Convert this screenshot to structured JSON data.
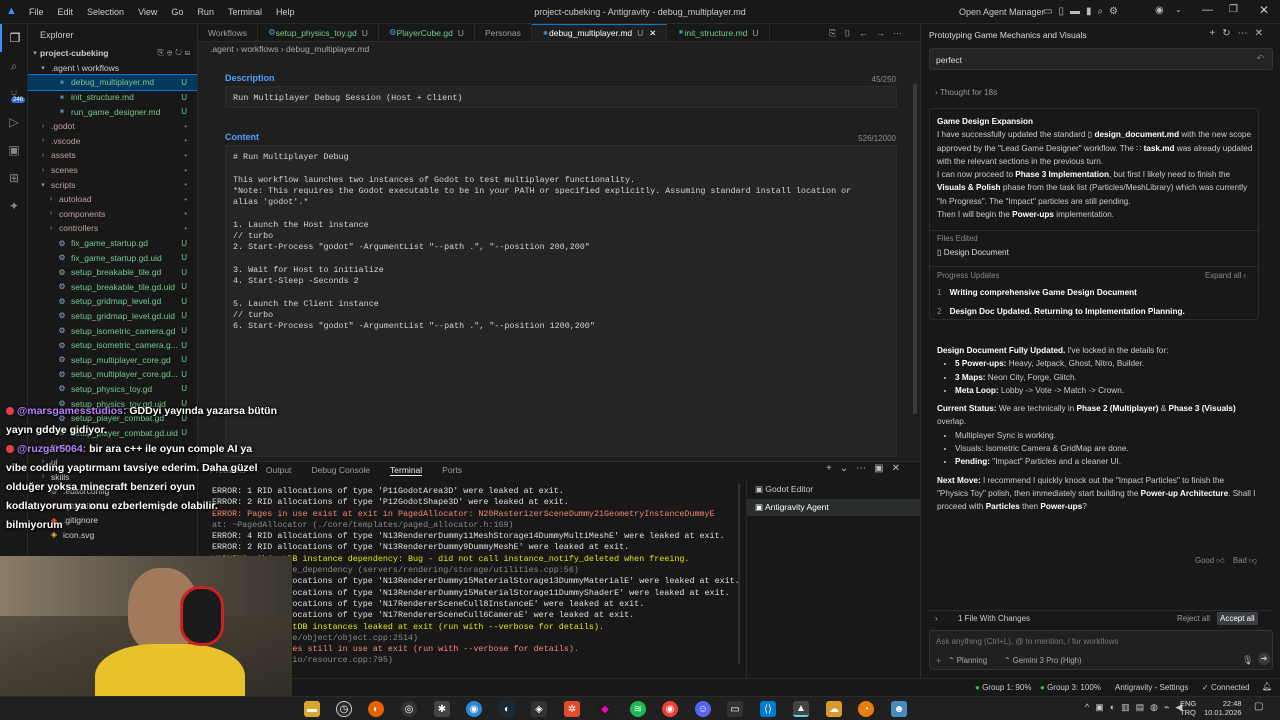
{
  "titlebar": {
    "menus": [
      "File",
      "Edit",
      "Selection",
      "View",
      "Go",
      "Run",
      "Terminal",
      "Help"
    ],
    "window_title": "project-cubeking - Antigravity - debug_multiplayer.md",
    "open_agent_manager": "Open Agent Manager"
  },
  "activity": {
    "badge": "246"
  },
  "explorer": {
    "header": "Explorer",
    "root": "project-cubeking",
    "items": [
      {
        "label": ".agent \\ workflows",
        "kind": "folder-open",
        "depth": 1
      },
      {
        "label": "debug_multiplayer.md",
        "kind": "md",
        "depth": 2,
        "status": "U",
        "selected": true
      },
      {
        "label": "init_structure.md",
        "kind": "md",
        "depth": 2,
        "status": "U"
      },
      {
        "label": "run_game_designer.md",
        "kind": "md",
        "depth": 2,
        "status": "U"
      },
      {
        "label": ".godot",
        "kind": "folder",
        "depth": 1,
        "status": "•"
      },
      {
        "label": ".vscode",
        "kind": "folder",
        "depth": 1,
        "status": "•"
      },
      {
        "label": "assets",
        "kind": "folder",
        "depth": 1,
        "status": "•"
      },
      {
        "label": "scenes",
        "kind": "folder",
        "depth": 1,
        "status": "•"
      },
      {
        "label": "scripts",
        "kind": "folder-open",
        "depth": 1,
        "status": "•"
      },
      {
        "label": "autoload",
        "kind": "folder",
        "depth": 2,
        "status": "•"
      },
      {
        "label": "components",
        "kind": "folder",
        "depth": 2,
        "status": "•"
      },
      {
        "label": "controllers",
        "kind": "folder",
        "depth": 2,
        "status": "•"
      },
      {
        "label": "fix_game_startup.gd",
        "kind": "gd",
        "depth": 2,
        "status": "U"
      },
      {
        "label": "fix_game_startup.gd.uid",
        "kind": "uid",
        "depth": 2,
        "status": "U"
      },
      {
        "label": "setup_breakable_tile.gd",
        "kind": "gd",
        "depth": 2,
        "status": "U"
      },
      {
        "label": "setup_breakable_tile.gd.uid",
        "kind": "uid",
        "depth": 2,
        "status": "U"
      },
      {
        "label": "setup_gridmap_level.gd",
        "kind": "gd",
        "depth": 2,
        "status": "U"
      },
      {
        "label": "setup_gridmap_level.gd.uid",
        "kind": "uid",
        "depth": 2,
        "status": "U"
      },
      {
        "label": "setup_isometric_camera.gd",
        "kind": "gd",
        "depth": 2,
        "status": "U"
      },
      {
        "label": "setup_isometric_camera.g...",
        "kind": "uid",
        "depth": 2,
        "status": "U"
      },
      {
        "label": "setup_multiplayer_core.gd",
        "kind": "gd",
        "depth": 2,
        "status": "U"
      },
      {
        "label": "setup_multiplayer_core.gd...",
        "kind": "uid",
        "depth": 2,
        "status": "U"
      },
      {
        "label": "setup_physics_toy.gd",
        "kind": "gd",
        "depth": 2,
        "status": "U"
      },
      {
        "label": "setup_physics_toy.gd.uid",
        "kind": "uid",
        "depth": 2,
        "status": "U"
      },
      {
        "label": "setup_player_combat.gd",
        "kind": "gd",
        "depth": 2,
        "status": "U"
      },
      {
        "label": "setup_player_combat.gd.uid",
        "kind": "uid",
        "depth": 2,
        "status": "U"
      },
      {
        "label": "tools",
        "kind": "folder",
        "depth": 1
      },
      {
        "label": "ui",
        "kind": "folder",
        "depth": 1
      },
      {
        "label": "skills",
        "kind": "folder",
        "depth": 1
      },
      {
        "label": ".editorconfig",
        "kind": "cfg",
        "depth": 1
      },
      {
        "label": ".gitattributes",
        "kind": "git",
        "depth": 1
      },
      {
        "label": ".gitignore",
        "kind": "git",
        "depth": 1
      },
      {
        "label": "icon.svg",
        "kind": "svg",
        "depth": 1
      }
    ]
  },
  "tabs": [
    {
      "label": "Workflows",
      "mod": ""
    },
    {
      "label": "setup_physics_toy.gd",
      "mod": "U"
    },
    {
      "label": "PlayerCube.gd",
      "mod": "U"
    },
    {
      "label": "Personas",
      "mod": ""
    },
    {
      "label": "debug_multiplayer.md",
      "mod": "U",
      "active": true
    },
    {
      "label": "init_structure.md",
      "mod": "U"
    }
  ],
  "breadcrumb": ".agent › workflows › debug_multiplayer.md",
  "description": {
    "label": "Description",
    "count": "45/250",
    "value": "Run Multiplayer Debug Session (Host + Client)"
  },
  "content": {
    "label": "Content",
    "count": "526/12000",
    "lines": [
      "# Run Multiplayer Debug",
      "",
      "This workflow launches two instances of Godot to test multiplayer functionality.",
      "*Note: This requires the Godot executable to be in your PATH or specified explicitly. Assuming standard install location or",
      "alias 'godot'.*",
      "",
      "1. Launch the Host instance",
      "// turbo",
      "2. Start-Process \"godot\" -ArgumentList \"--path .\", \"--position 200,200\"",
      "",
      "3. Wait for Host to initialize",
      "4. Start-Sleep -Seconds 2",
      "",
      "5. Launch the Client instance",
      "// turbo",
      "6. Start-Process \"godot\" -ArgumentList \"--path .\", \"--position 1200,200\""
    ]
  },
  "panel": {
    "tabs": [
      "Problems",
      "Output",
      "Debug Console",
      "Terminal",
      "Ports"
    ],
    "terminal_lines": [
      {
        "t": "ERROR: 1 RID allocations of type 'P11GodotArea3D' were leaked at exit.",
        "c": ""
      },
      {
        "t": "ERROR: 2 RID allocations of type 'P12GodotShape3D' were leaked at exit.",
        "c": ""
      },
      {
        "t": "ERROR: Pages in use exist at exit in PagedAllocator: N20RasterizerSceneDummy21GeometryInstanceDummyE",
        "c": "err"
      },
      {
        "t": "   at: ~PagedAllocator (./core/templates/paged_allocator.h:169)",
        "c": "dim"
      },
      {
        "t": "ERROR: 4 RID allocations of type 'N13RendererDummy11MeshStorage14DummyMultiMeshE' were leaked at exit.",
        "c": ""
      },
      {
        "t": "ERROR: 2 RID allocations of type 'N13RendererDummy9DummyMeshE' were leaked at exit.",
        "c": ""
      },
      {
        "t": "WARNING: ObjectDB instance dependency: Bug - did not call instance_notify_deleted when freeing.",
        "c": "warn"
      },
      {
        "t": "   at: free_instance_dependency (servers/rendering/storage/utilities.cpp:56)",
        "c": "dim"
      },
      {
        "t": "ERROR: 4 RID allocations of type 'N13RendererDummy15MaterialStorage13DummyMaterialE' were leaked at exit.",
        "c": ""
      },
      {
        "t": "ERROR: 5 RID allocations of type 'N13RendererDummy15MaterialStorage11DummyShaderE' were leaked at exit.",
        "c": ""
      },
      {
        "t": "ERROR: 1 RID allocations of type 'N17RendererSceneCull8InstanceE' were leaked at exit.",
        "c": ""
      },
      {
        "t": "ERROR: 1 RID allocations of type 'N17RendererSceneCull6CameraE' were leaked at exit.",
        "c": ""
      },
      {
        "t": "WARNING: 6 ObjectDB instances leaked at exit (run with --verbose for details).",
        "c": "warn"
      },
      {
        "t": "   at: cleanup (core/object/object.cpp:2514)",
        "c": "dim"
      },
      {
        "t": "ERROR: 5 resources still in use at exit (run with --verbose for details).",
        "c": "err"
      },
      {
        "t": "   at: clear (core/io/resource.cpp:795)",
        "c": "dim"
      }
    ],
    "terminals": [
      "Godot Editor",
      "Antigravity Agent"
    ]
  },
  "agent": {
    "title": "Prototyping Game Mechanics and Visuals",
    "input_text": "perfect",
    "thought": "Thought for 18s",
    "section1_title": "Game Design Expansion",
    "section1_text_a": "I have successfully updated the standard",
    "file1": "design_document.md",
    "section1_text_b": "with the new scope approved by the \"Lead Game Designer\" workflow. The",
    "file2": "task.md",
    "section1_text_c": "was already updated with the relevant sections in the previous turn.",
    "section1_text_d": "I can now proceed to",
    "phase3": "Phase 3 Implementation",
    "section1_text_e": ", but first I likely need to finish the",
    "visuals": "Visuals & Polish",
    "section1_text_f": "phase from the task list (Particles/MeshLibrary) which was currently \"In Progress\". The \"Impact\" particles are still pending.",
    "section1_text_g": "Then I will begin the",
    "powerups": "Power-ups",
    "section1_text_h": "implementation.",
    "files_edited_label": "Files Edited",
    "files_edited": [
      "Design Document"
    ],
    "progress_label": "Progress Updates",
    "expand_all": "Expand all",
    "progress": [
      {
        "n": "1",
        "t": "Writing comprehensive Game Design Document"
      },
      {
        "n": "2",
        "t": "Design Doc Updated. Returning to Implementation Planning."
      }
    ],
    "msg_title": "Design Document Fully Updated.",
    "msg_intro": "I've locked in the details for:",
    "bullets1": [
      {
        "b": "5 Power-ups:",
        "t": " Heavy, Jetpack, Ghost, Nitro, Builder."
      },
      {
        "b": "3 Maps:",
        "t": " Neon City, Forge, Glitch."
      },
      {
        "b": "Meta Loop:",
        "t": " Lobby -> Vote -> Match -> Crown."
      }
    ],
    "status_label": "Current Status:",
    "status_a": "We are technically in",
    "phase2": "Phase 2 (Multiplayer)",
    "status_b": "&",
    "phase3v": "Phase 3 (Visuals)",
    "status_c": "overlap.",
    "bullets2": [
      {
        "b": "",
        "t": "Multiplayer Sync is working."
      },
      {
        "b": "",
        "t": "Visuals: Isometric Camera & GridMap are done."
      },
      {
        "b": "Pending:",
        "t": " \"Impact\" Particles and a cleaner UI."
      }
    ],
    "next_label": "Next Move:",
    "next_a": "I recommend I quickly knock out the \"Impact Particles\" to finish the \"Physics Toy\" polish, then immediately start building the",
    "powerup_arch": "Power-up Architecture",
    "next_b": ". Shall I proceed with",
    "particles": "Particles",
    "next_c": "then",
    "next_d": "Power-ups",
    "next_e": "?",
    "good": "Good",
    "bad": "Bad",
    "changes": "1 File With Changes",
    "reject_all": "Reject all",
    "accept_all": "Accept all",
    "ask_placeholder": "Ask anything (Ctrl+L), @ to mention, / for workflows",
    "mode": "Planning",
    "model": "Gemini 3 Pro (High)"
  },
  "statusbar": {
    "left": "0 △ 0",
    "group1": "Group 1: 90%",
    "group3": "Group 3: 100%",
    "settings": "Antigravity - Settings",
    "connected": "Connected"
  },
  "chat": [
    {
      "user": "@marsgamesstudios:",
      "msg": "GDDyi yayında yazarsa bütün"
    },
    {
      "user": "",
      "msg": "yayın gddye gidiyor."
    },
    {
      "user": "@ruzgar5064:",
      "msg": "bir ara c++ ile oyun comple AI ya"
    },
    {
      "user": "",
      "msg": "vibe coding yaptırmanı tavsiye ederim. Daha güzel"
    },
    {
      "user": "",
      "msg": "olduğer yoksa minecraft benzeri oyun"
    },
    {
      "user": "",
      "msg": "kodlatıyorum ya onu ezberlemişde olabilir."
    },
    {
      "user": "",
      "msg": "bilmiyorum"
    }
  ],
  "taskbar": {
    "lang": "ENG",
    "lang2": "TRQ",
    "time": "22:48",
    "date": "10.01.2026"
  }
}
